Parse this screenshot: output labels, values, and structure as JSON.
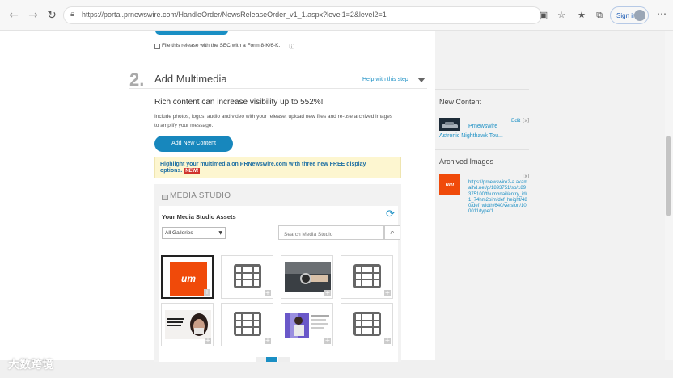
{
  "browser": {
    "url": "https://portal.prnewswire.com/HandleOrder/NewsReleaseOrder_v1_1.aspx?level1=2&level2=1",
    "signin_label": "Sign in"
  },
  "page": {
    "sec_checkbox_label": "File this release with the SEC with a Form 8-K/6-K.",
    "step_number": "2.",
    "step_title": "Add Multimedia",
    "help_link": "Help with this step",
    "rich_heading": "Rich content can increase visibility up to 552%!",
    "description": "Include photos, logos, audio and video with your release: upload new files and re-use archived images to amplify your message.",
    "add_button": "Add New Content",
    "highlight_text": "Highlight your multimedia on PRNewswire.com with three new FREE display options.",
    "new_badge": "NEW!",
    "studio_title": "MEDIA STUDIO",
    "assets_title": "Your Media Studio Assets",
    "gallery_select_value": "All Galleries",
    "search_placeholder": "Search Media Studio"
  },
  "thumbnails": [
    {
      "type": "logo",
      "label": "um",
      "selected": true
    },
    {
      "type": "video"
    },
    {
      "type": "photo",
      "subject": "wristwatch"
    },
    {
      "type": "video"
    },
    {
      "type": "photo",
      "subject": "masked face"
    },
    {
      "type": "video"
    },
    {
      "type": "photo",
      "subject": "presenter"
    },
    {
      "type": "video"
    }
  ],
  "sidebar": {
    "new_content_heading": "New Content",
    "new_content_source": "Prnewswire",
    "new_content_title": "Astronic Nighthawk Tou...",
    "edit_label": "Edit",
    "archived_heading": "Archived Images",
    "archived_logo_label": "um",
    "archived_url": "https://prnewswire2-a.akamaihd.net/p/1893751/sp/189375100/thumbnail/entry_id/1_74hm2bim/def_height/480/def_width/640/version/100011/type/1"
  },
  "watermark": "大数跨境",
  "colors": {
    "accent": "#1787bd",
    "logo_orange": "#f04a0a",
    "highlight_bg": "#fdf6d0",
    "new_badge": "#d0342c"
  }
}
